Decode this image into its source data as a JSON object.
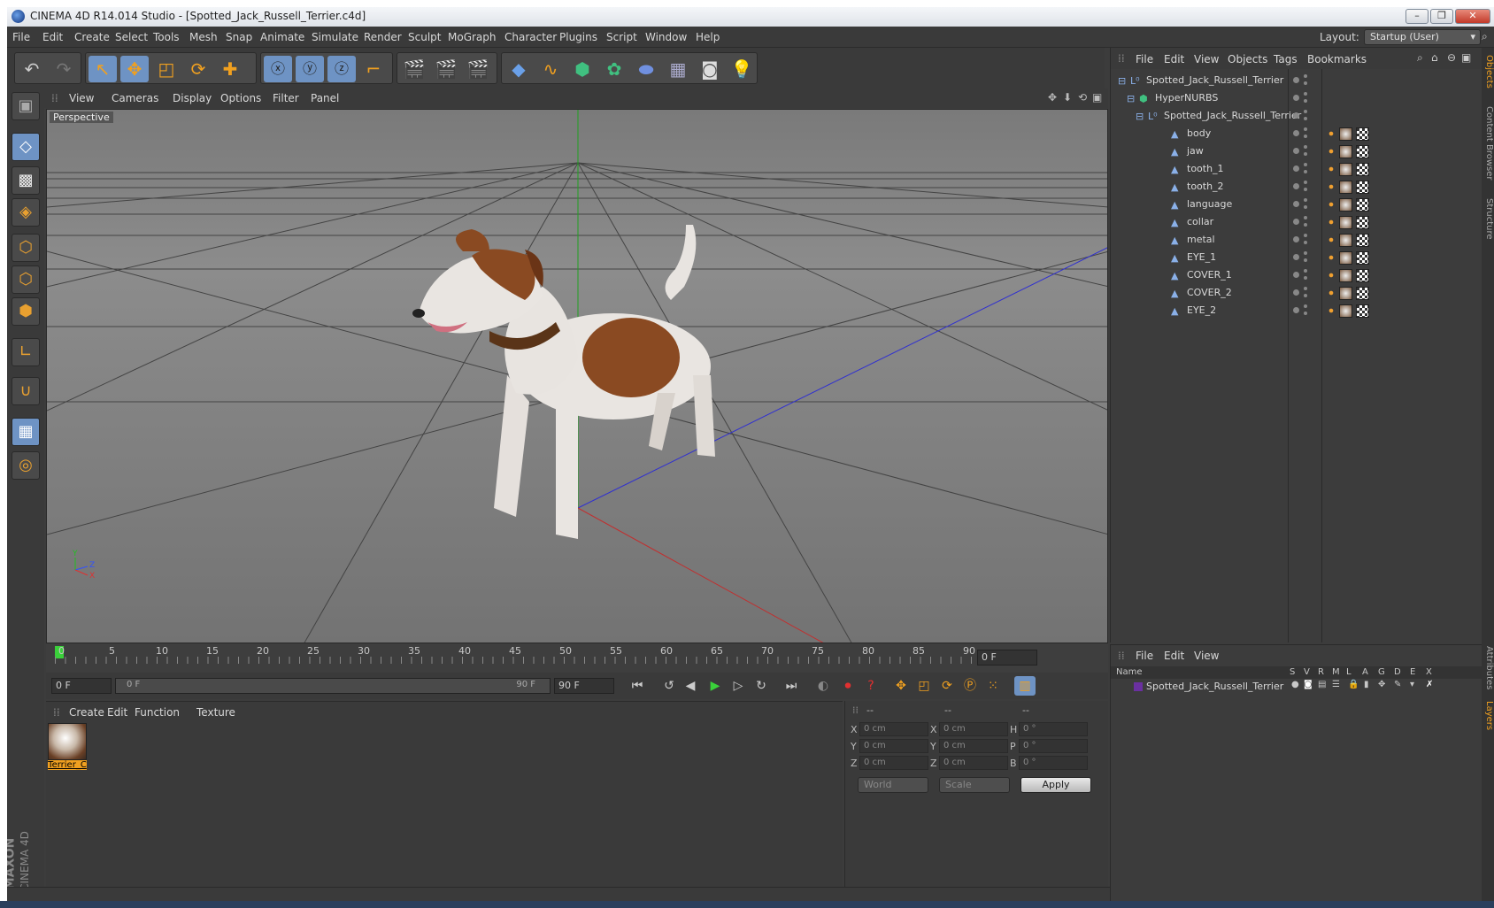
{
  "window": {
    "title": "CINEMA 4D R14.014 Studio - [Spotted_Jack_Russell_Terrier.c4d]",
    "min": "–",
    "max": "❐",
    "close": "✕"
  },
  "menu": [
    "File",
    "Edit",
    "Create",
    "Select",
    "Tools",
    "Mesh",
    "Snap",
    "Animate",
    "Simulate",
    "Render",
    "Sculpt",
    "MoGraph",
    "Character",
    "Plugins",
    "Script",
    "Window",
    "Help"
  ],
  "layout": {
    "label": "Layout:",
    "value": "Startup (User)"
  },
  "viewport": {
    "menu": [
      "View",
      "Cameras",
      "Display",
      "Options",
      "Filter",
      "Panel"
    ],
    "label": "Perspective",
    "axes": {
      "y": "Y",
      "z": "Z",
      "x": "X"
    }
  },
  "timeline": {
    "ticks": [
      "0",
      "5",
      "10",
      "15",
      "20",
      "25",
      "30",
      "35",
      "40",
      "45",
      "50",
      "55",
      "60",
      "65",
      "70",
      "75",
      "80",
      "85",
      "90"
    ],
    "frame_field": "0 F",
    "start_field": "0 F",
    "range_start": "0 F",
    "range_end": "90 F",
    "end_field": "90 F"
  },
  "material": {
    "menu": [
      "Create",
      "Edit",
      "Function",
      "Texture"
    ],
    "items": [
      {
        "name": "Terrier_C"
      }
    ]
  },
  "coords": {
    "headers": [
      "--",
      "--",
      "--"
    ],
    "rows": [
      {
        "a": "X",
        "av": "0 cm",
        "b": "X",
        "bv": "0 cm",
        "c": "H",
        "cv": "0 °"
      },
      {
        "a": "Y",
        "av": "0 cm",
        "b": "Y",
        "bv": "0 cm",
        "c": "P",
        "cv": "0 °"
      },
      {
        "a": "Z",
        "av": "0 cm",
        "b": "Z",
        "bv": "0 cm",
        "c": "B",
        "cv": "0 °"
      }
    ],
    "world": "World",
    "scale": "Scale",
    "apply": "Apply"
  },
  "objects": {
    "menu": [
      "File",
      "Edit",
      "View",
      "Objects",
      "Tags",
      "Bookmarks"
    ],
    "tree": [
      {
        "name": "Spotted_Jack_Russell_Terrier",
        "level": 0,
        "tags": []
      },
      {
        "name": "HyperNURBS",
        "level": 1,
        "tags": []
      },
      {
        "name": "Spotted_Jack_Russell_Terrier",
        "level": 2,
        "tags": []
      },
      {
        "name": "body",
        "level": 3,
        "tags": [
          "phong",
          "mat",
          "chk"
        ]
      },
      {
        "name": "jaw",
        "level": 3,
        "tags": [
          "phong",
          "mat",
          "chk"
        ]
      },
      {
        "name": "tooth_1",
        "level": 3,
        "tags": [
          "phong",
          "mat",
          "chk"
        ]
      },
      {
        "name": "tooth_2",
        "level": 3,
        "tags": [
          "phong",
          "mat",
          "chk"
        ]
      },
      {
        "name": "language",
        "level": 3,
        "tags": [
          "phong",
          "mat",
          "chk"
        ]
      },
      {
        "name": "collar",
        "level": 3,
        "tags": [
          "phong",
          "mat",
          "chk"
        ]
      },
      {
        "name": "metal",
        "level": 3,
        "tags": [
          "phong",
          "mat",
          "chk"
        ]
      },
      {
        "name": "EYE_1",
        "level": 3,
        "tags": [
          "phong",
          "mat",
          "chk"
        ]
      },
      {
        "name": "COVER_1",
        "level": 3,
        "tags": [
          "phong",
          "mat",
          "chk"
        ]
      },
      {
        "name": "COVER_2",
        "level": 3,
        "tags": [
          "phong",
          "mat",
          "chk"
        ]
      },
      {
        "name": "EYE_2",
        "level": 3,
        "tags": [
          "phong",
          "mat",
          "chk"
        ]
      }
    ]
  },
  "layers": {
    "menu": [
      "File",
      "Edit",
      "View"
    ],
    "columns": [
      "Name",
      "S",
      "V",
      "R",
      "M",
      "L",
      "A",
      "G",
      "D",
      "E",
      "X"
    ],
    "rows": [
      {
        "name": "Spotted_Jack_Russell_Terrier"
      }
    ]
  },
  "right_tabs": [
    "Objects",
    "Content Browser",
    "Structure",
    "Attributes",
    "Layers"
  ],
  "branding": {
    "l1": "MAXON",
    "l2": "CINEMA 4D"
  },
  "colors": {
    "accent": "#6e93c4",
    "orange": "#f0a020",
    "axis_x": "#c03030",
    "axis_y": "#20a020",
    "axis_z": "#3030d0"
  }
}
